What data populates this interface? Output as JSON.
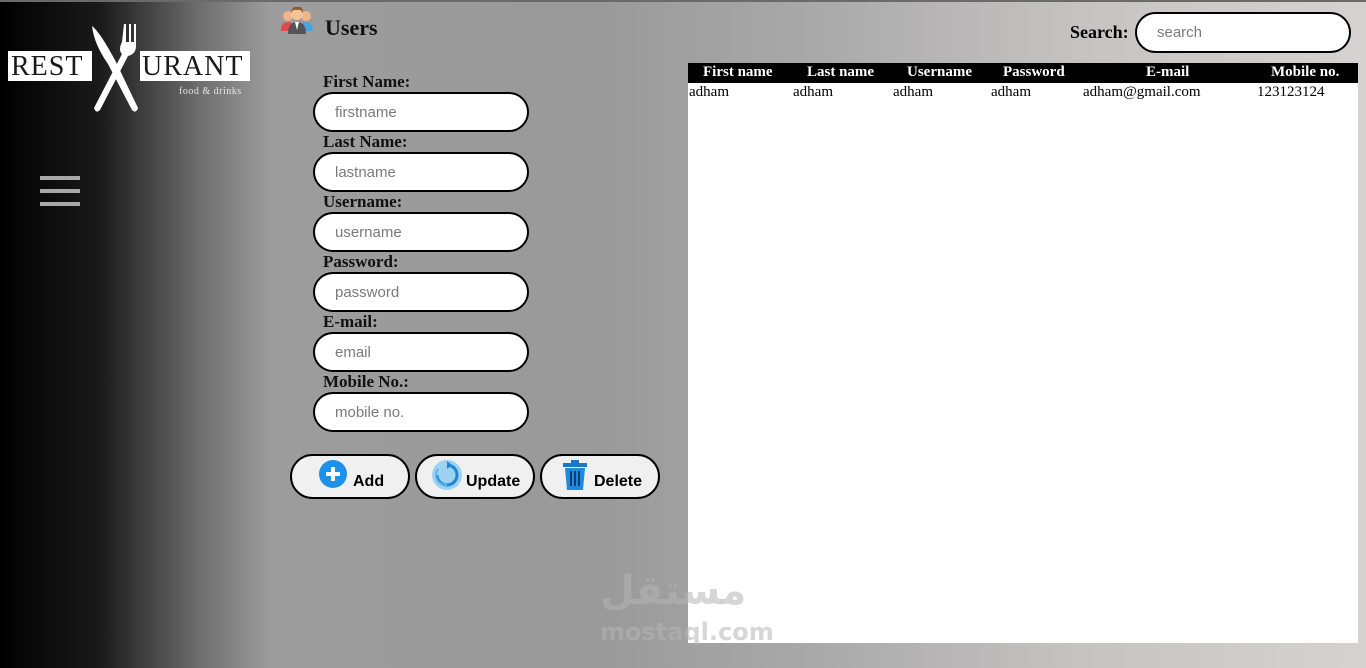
{
  "logo": {
    "left_text": "REST",
    "right_text": "URANT",
    "tagline": "food & drinks"
  },
  "header": {
    "title": "Users"
  },
  "form": {
    "fields": [
      {
        "label": "First Name:",
        "placeholder": "firstname",
        "value": ""
      },
      {
        "label": "Last Name:",
        "placeholder": "lastname",
        "value": ""
      },
      {
        "label": "Username:",
        "placeholder": "username",
        "value": ""
      },
      {
        "label": "Password:",
        "placeholder": "password",
        "value": ""
      },
      {
        "label": "E-mail:",
        "placeholder": "email",
        "value": ""
      },
      {
        "label": "Mobile No.:",
        "placeholder": "mobile no.",
        "value": ""
      }
    ],
    "buttons": {
      "add": "Add",
      "update": "Update",
      "delete": "Delete"
    }
  },
  "search": {
    "label": "Search:",
    "placeholder": "search",
    "value": ""
  },
  "table": {
    "columns": [
      "First name",
      "Last name",
      "Username",
      "Password",
      "E-mail",
      "Mobile no."
    ],
    "rows": [
      [
        "adham",
        "adham",
        "adham",
        "adham",
        "adham@gmail.com",
        "123123124"
      ]
    ]
  },
  "watermark": {
    "arabic": "مستقل",
    "latin": "mostaql.com"
  },
  "colors": {
    "add_icon": "#1e90e8",
    "update_icon": "#3aa3e0",
    "delete_icon": "#1b78c8"
  },
  "icons": [
    "fork-knife-icon",
    "menu-icon",
    "users-icon",
    "plus-circle-icon",
    "refresh-icon",
    "trash-icon"
  ]
}
